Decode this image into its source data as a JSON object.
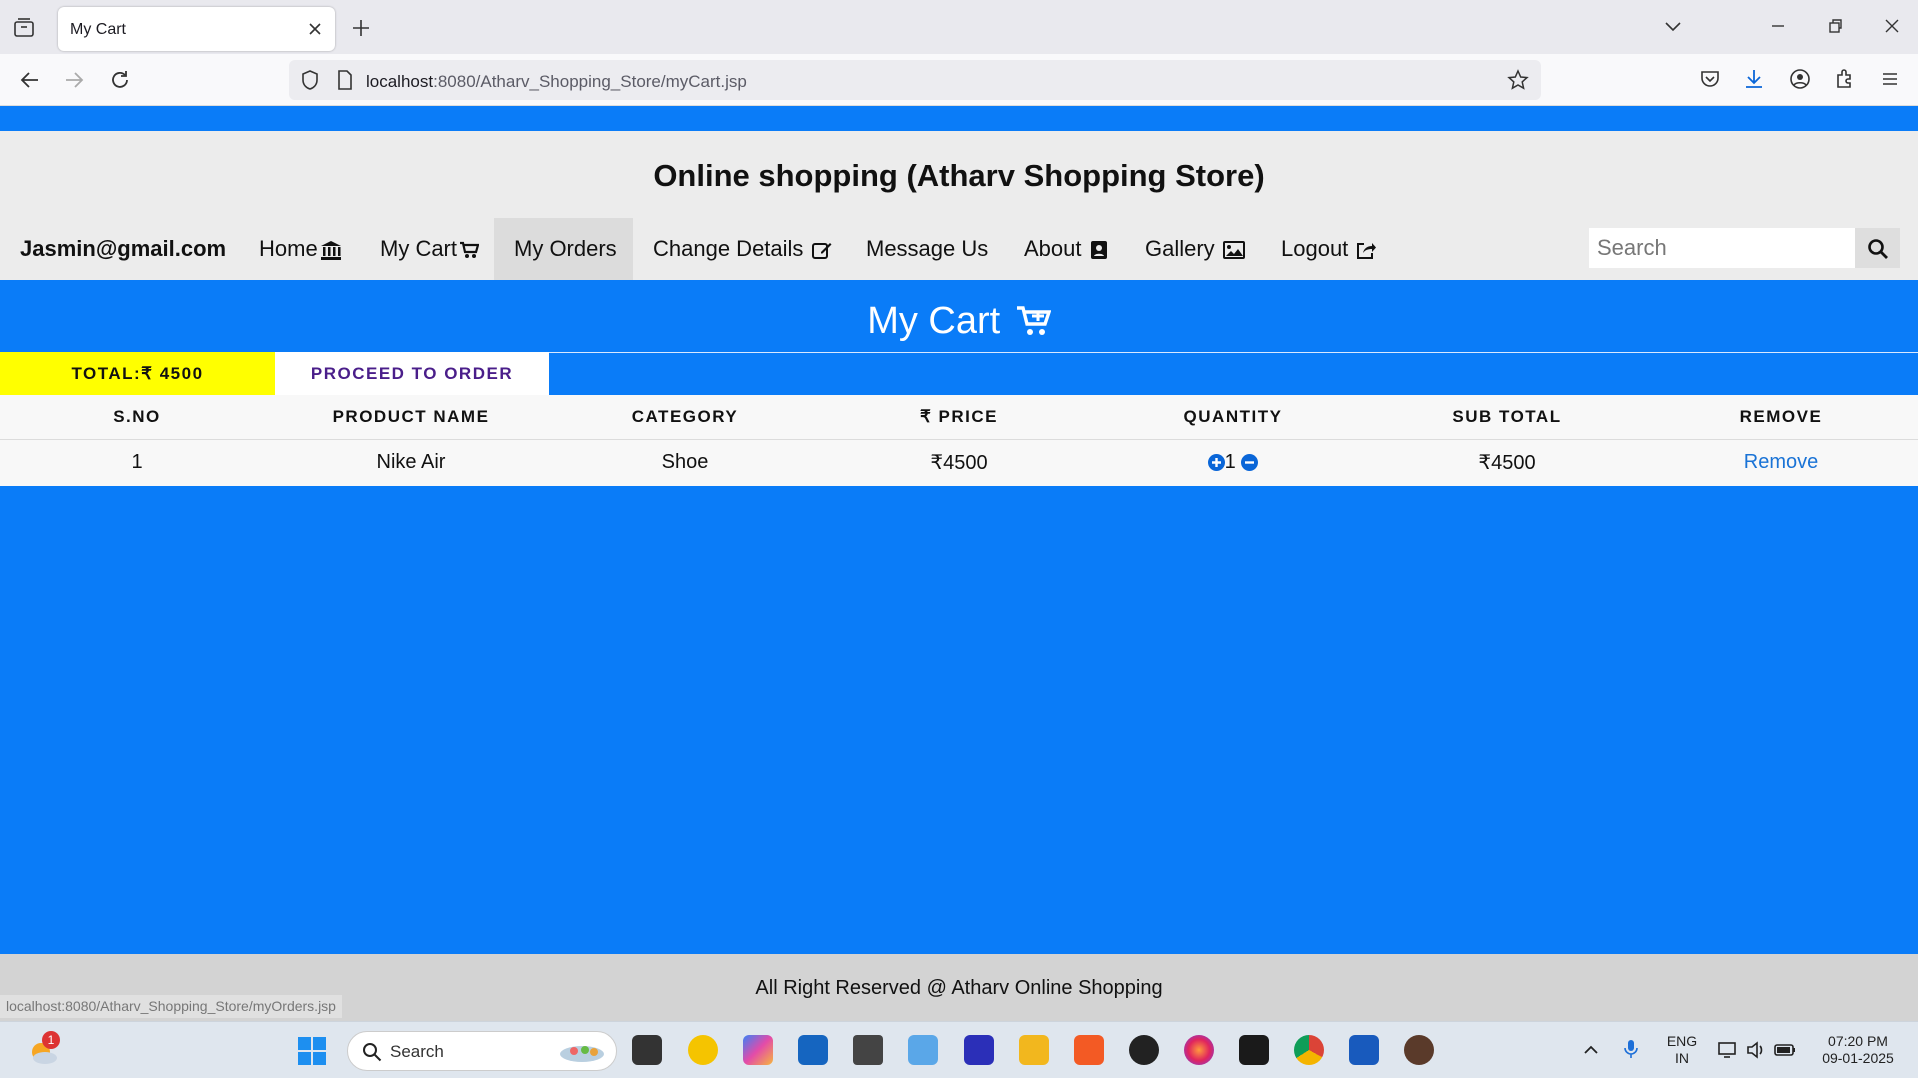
{
  "browser": {
    "tab_title": "My Cart",
    "url_host": "localhost",
    "url_path": ":8080/Atharv_Shopping_Store/myCart.jsp",
    "status_url": "localhost:8080/Atharv_Shopping_Store/myOrders.jsp"
  },
  "site": {
    "title": "Online shopping (Atharv Shopping Store)"
  },
  "menu": {
    "user": "Jasmin@gmail.com",
    "items": [
      {
        "label": "Home",
        "icon": "bank-icon"
      },
      {
        "label": "My Cart",
        "icon": "cart-icon"
      },
      {
        "label": "My Orders",
        "icon": ""
      },
      {
        "label": "Change Details",
        "icon": "edit-icon"
      },
      {
        "label": "Message Us",
        "icon": ""
      },
      {
        "label": "About",
        "icon": "contact-book-icon"
      },
      {
        "label": "Gallery",
        "icon": "image-icon"
      },
      {
        "label": "Logout",
        "icon": "share-icon"
      }
    ],
    "search_placeholder": "Search"
  },
  "cart": {
    "heading": "My Cart",
    "total_label": "TOTAL:₹ 4500",
    "proceed_label": "PROCEED TO ORDER",
    "columns": [
      "S.NO",
      "PRODUCT NAME",
      "CATEGORY",
      "₹ PRICE",
      "QUANTITY",
      "SUB TOTAL",
      "REMOVE"
    ],
    "rows": [
      {
        "sno": "1",
        "product": "Nike Air",
        "category": "Shoe",
        "price": "₹4500",
        "quantity": "1",
        "subtotal": "₹4500",
        "remove": "Remove"
      }
    ]
  },
  "footer": {
    "text": "All Right Reserved @ Atharv Online Shopping"
  },
  "taskbar": {
    "search": "Search",
    "weather_badge": "1",
    "lang": "ENG",
    "region": "IN",
    "time": "07:20 PM",
    "date": "09-01-2025"
  },
  "colors": {
    "page_blue": "#0a7cf8",
    "total_yellow": "#ffff00",
    "proceed_text": "#4a1e8a",
    "remove_link": "#1a73d6"
  }
}
